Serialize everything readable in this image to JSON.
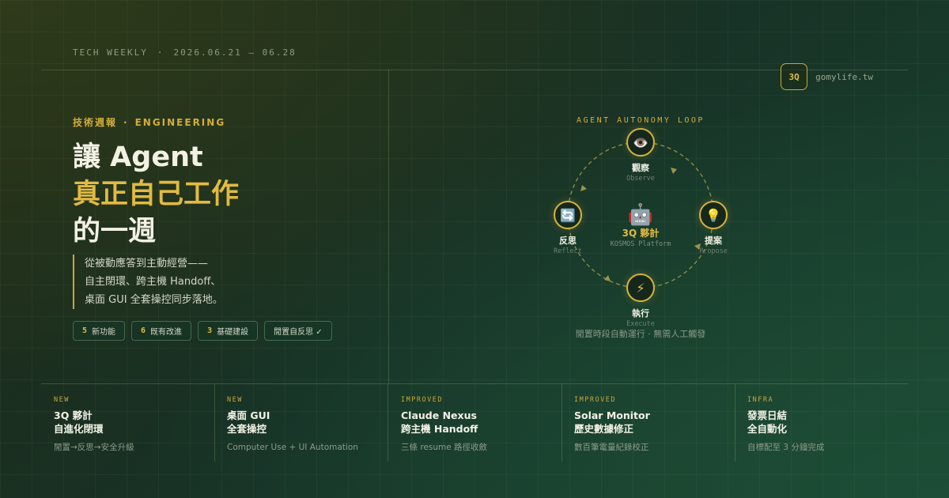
{
  "header": {
    "publication": "TECH WEEKLY",
    "separator": "·",
    "date_range": "2026.06.21 – 06.28",
    "brand_logo": "3Q",
    "brand_url": "gomylife.tw"
  },
  "hero": {
    "eyebrow_zh": "技術週報",
    "eyebrow_sep": "·",
    "eyebrow_en": "ENGINEERING",
    "title_line1": "讓 Agent",
    "title_line2": "真正自己工作",
    "title_line3": "的一週",
    "subtitle_line1": "從被動應答到主動經營——",
    "subtitle_line2": "自主閉環、跨主機 Handoff、",
    "subtitle_line3": "桌面 GUI 全套操控同步落地。",
    "chips": [
      {
        "num": "5",
        "label": "新功能"
      },
      {
        "num": "6",
        "label": "既有改進"
      },
      {
        "num": "3",
        "label": "基礎建設"
      },
      {
        "num": "",
        "label": "閒置自反思 ✓"
      }
    ]
  },
  "loop": {
    "title": "AGENT AUTONOMY LOOP",
    "center": {
      "icon": "robot-icon",
      "glyph": "🤖",
      "name": "3Q 夥計",
      "platform": "KOSMOS Platform"
    },
    "nodes": [
      {
        "id": "observe",
        "icon": "eye-icon",
        "glyph": "👁️",
        "zh": "觀察",
        "en": "Observe"
      },
      {
        "id": "propose",
        "icon": "lightbulb-icon",
        "glyph": "💡",
        "zh": "提案",
        "en": "Propose"
      },
      {
        "id": "execute",
        "icon": "lightning-icon",
        "glyph": "⚡",
        "zh": "執行",
        "en": "Execute"
      },
      {
        "id": "reflect",
        "icon": "refresh-icon",
        "glyph": "🔄",
        "zh": "反思",
        "en": "Reflect"
      }
    ],
    "note": "閒置時段自動運行 · 無需人工觸發",
    "accent_color": "#d8b23c"
  },
  "features": [
    {
      "tag": "NEW",
      "title_line1": "3Q 夥計",
      "title_line2": "自進化閉環",
      "desc": "閒置→反思→安全升級"
    },
    {
      "tag": "NEW",
      "title_line1": "桌面 GUI",
      "title_line2": "全套操控",
      "desc": "Computer Use + UI Automation"
    },
    {
      "tag": "IMPROVED",
      "title_line1": "Claude Nexus",
      "title_line2": "跨主機 Handoff",
      "desc": "三條 resume 路徑收斂"
    },
    {
      "tag": "IMPROVED",
      "title_line1": "Solar Monitor",
      "title_line2": "歷史數據修正",
      "desc": "數百筆電量紀錄校正"
    },
    {
      "tag": "INFRA",
      "title_line1": "發票日結",
      "title_line2": "全自動化",
      "desc": "自標配至 3 分鐘完成"
    }
  ]
}
